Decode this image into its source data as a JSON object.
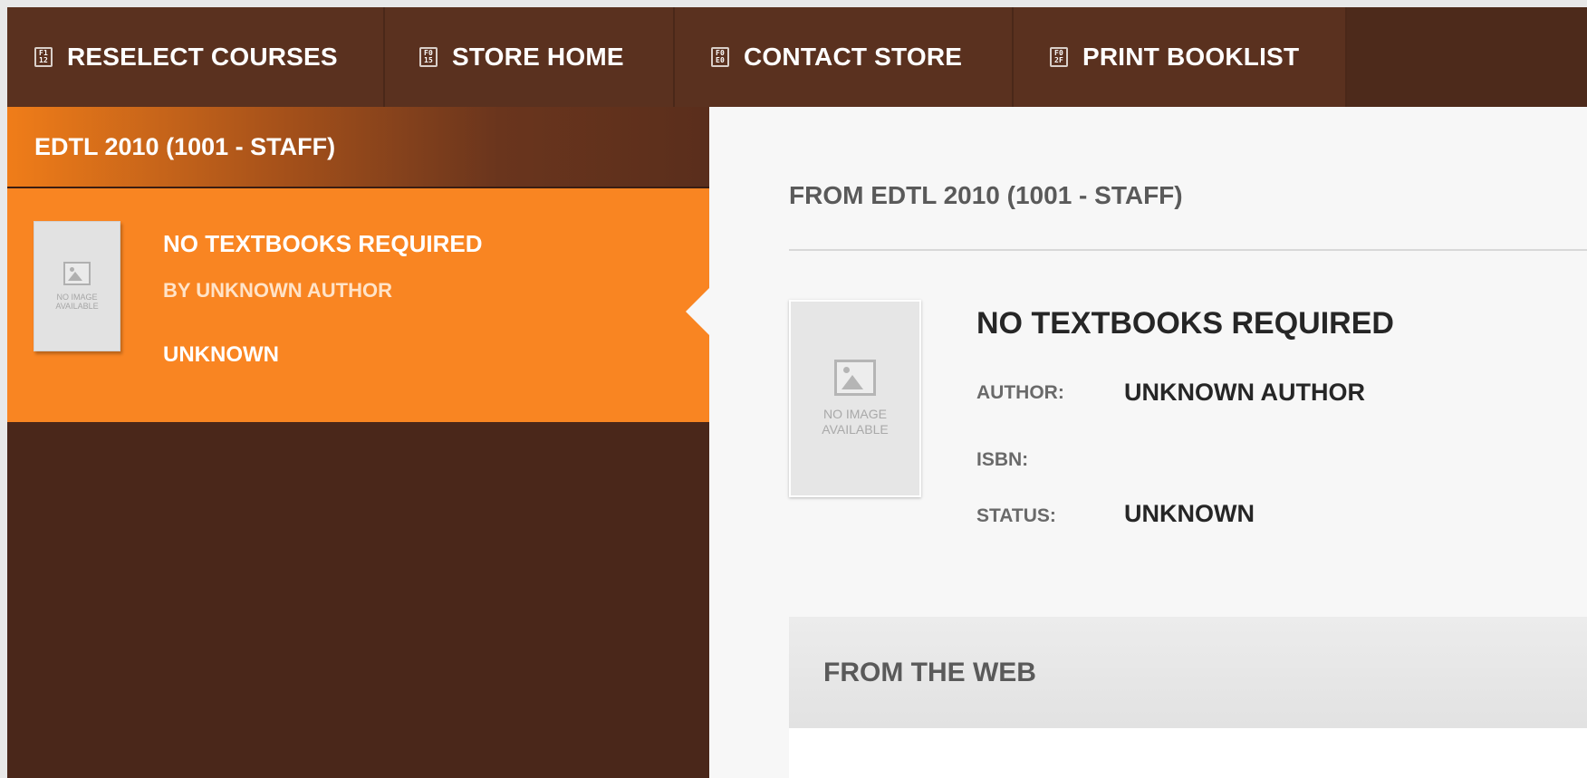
{
  "topnav": {
    "items": [
      {
        "label": "RESELECT COURSES",
        "key": "F1\n12"
      },
      {
        "label": "STORE HOME",
        "key": "F0\n15"
      },
      {
        "label": "CONTACT STORE",
        "key": "F0\nE0"
      },
      {
        "label": "PRINT BOOKLIST",
        "key": "F0\n2F"
      }
    ]
  },
  "sidebar": {
    "course": "EDTL 2010 (1001 - STAFF)",
    "book": {
      "title": "NO TEXTBOOKS REQUIRED",
      "author": "BY UNKNOWN AUTHOR",
      "status": "UNKNOWN",
      "no_image": "NO IMAGE AVAILABLE"
    }
  },
  "main": {
    "from_heading": "FROM EDTL 2010 (1001 - STAFF)",
    "no_image": "NO IMAGE AVAILABLE",
    "title": "NO TEXTBOOKS REQUIRED",
    "author_label": "AUTHOR:",
    "author_value": "UNKNOWN AUTHOR",
    "isbn_label": "ISBN:",
    "status_label": "STATUS:",
    "status_value": "UNKNOWN",
    "web_heading": "FROM THE WEB"
  },
  "colors": {
    "nav_bg": "#5a311f",
    "sidebar_bg": "#4a271a",
    "accent_orange": "#f98522",
    "main_bg": "#f7f7f7"
  }
}
